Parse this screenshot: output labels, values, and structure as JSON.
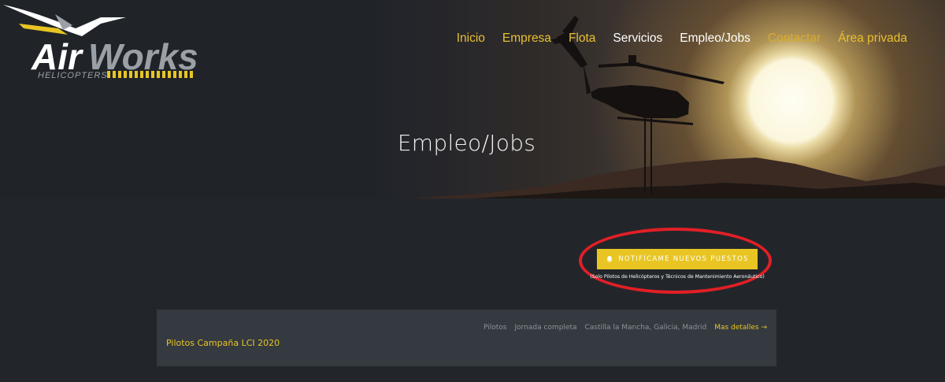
{
  "brand": {
    "name": "AirWorks",
    "name_air": "Air",
    "name_works": "Works",
    "tagline": "HELICOPTERS"
  },
  "nav": {
    "items": [
      {
        "label": "Inicio"
      },
      {
        "label": "Empresa"
      },
      {
        "label": "Flota"
      },
      {
        "label": "Servicios"
      },
      {
        "label": "Empleo/Jobs"
      },
      {
        "label": "Contactar"
      },
      {
        "label": "Área privada"
      }
    ]
  },
  "hero": {
    "title": "Empleo/Jobs"
  },
  "notify": {
    "button_label": "NOTIFÍCAME NUEVOS PUESTOS",
    "button_icon": "bell-icon",
    "note": "(Solo Pilotos de Helicópteros y Técnicos de Mantenimiento Aeronáutico)"
  },
  "jobs": [
    {
      "title": "Pilotos Campaña LCI 2020",
      "category": "Pilotos",
      "type": "Jornada completa",
      "location": "Castilla la Mancha, Galicia, Madrid",
      "details_label": "Mas detalles →"
    }
  ],
  "colors": {
    "accent": "#e8c523",
    "background": "#22262b",
    "card": "#353a40",
    "highlight": "#e21f26"
  }
}
